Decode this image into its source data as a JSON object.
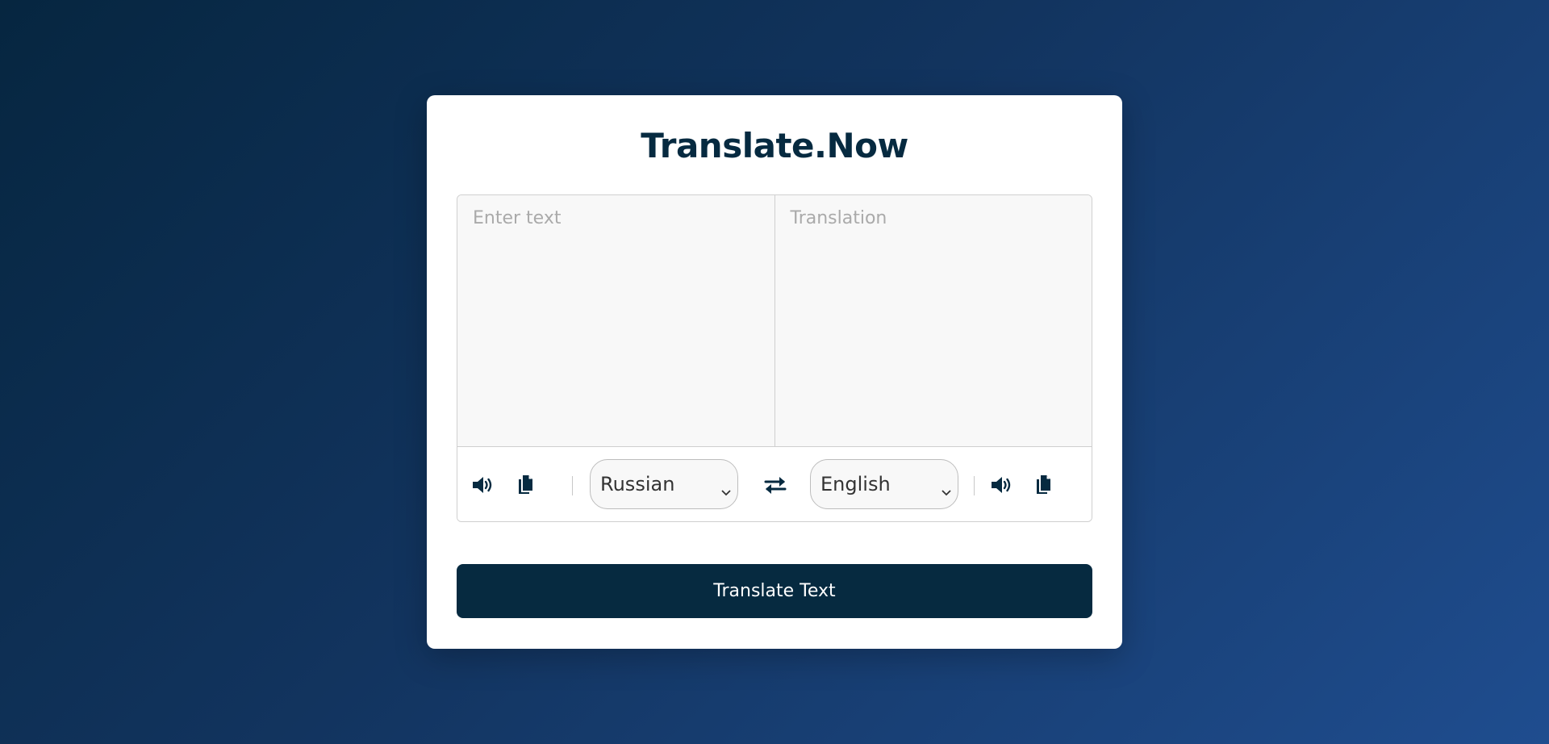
{
  "app": {
    "title": "Translate.Now"
  },
  "from": {
    "placeholder": "Enter text",
    "language": "Russian"
  },
  "to": {
    "placeholder": "Translation",
    "language": "English"
  },
  "icons": {
    "speaker": "speaker-icon",
    "copy": "copy-icon",
    "exchange": "exchange-icon",
    "chevron": "chevron-down-icon"
  },
  "actions": {
    "translate_label": "Translate Text"
  },
  "colors": {
    "primary": "#062a40",
    "background_start": "#062640",
    "background_end": "#1f4d8f"
  }
}
